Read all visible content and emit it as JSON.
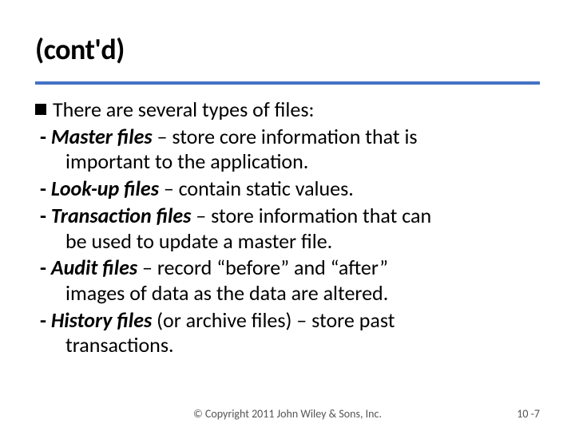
{
  "title": "(cont'd)",
  "lead": "There are several types of files:",
  "items": [
    {
      "term": "Master files",
      "paren": "",
      "desc": " – store core information that is",
      "cont": "important to the application."
    },
    {
      "term": "Look-up files",
      "paren": "",
      "desc": " – contain static values.",
      "cont": ""
    },
    {
      "term": "Transaction files",
      "paren": "",
      "desc": " – store information that can",
      "cont": "be used to update a master file."
    },
    {
      "term": "Audit files",
      "paren": "",
      "desc": " – record “before” and “after”",
      "cont": "images of data as the data are altered."
    },
    {
      "term": "History files",
      "paren": " (or archive files)",
      "desc": " – store past",
      "cont": "transactions."
    }
  ],
  "footer": {
    "copyright": "© Copyright 2011 John Wiley & Sons, Inc.",
    "pagenum": "10 -7"
  }
}
